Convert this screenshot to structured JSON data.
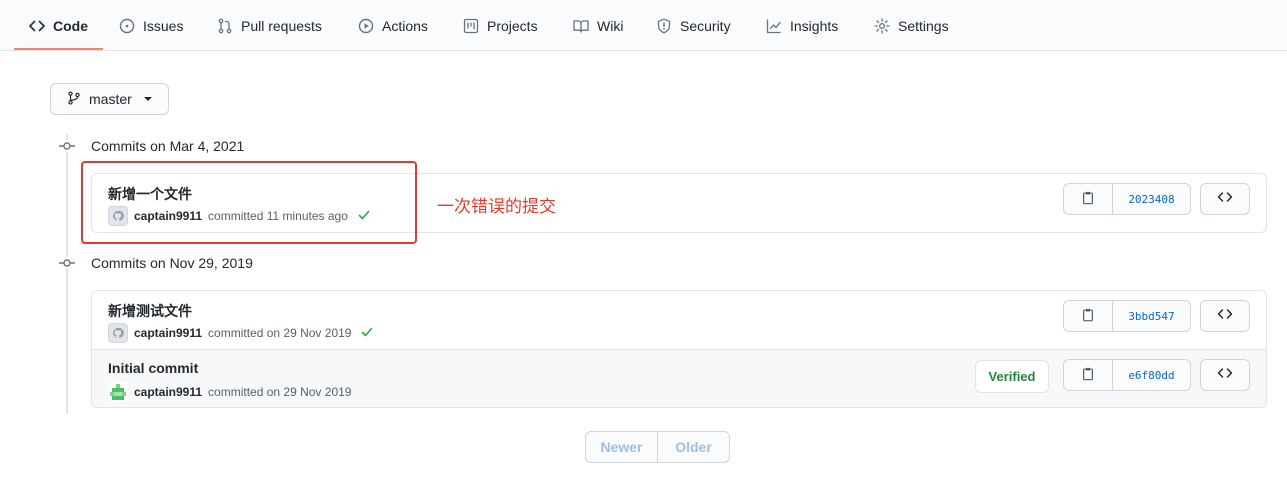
{
  "nav": {
    "tabs": [
      {
        "label": "Code",
        "icon": "code-icon",
        "active": true
      },
      {
        "label": "Issues",
        "icon": "issue-icon"
      },
      {
        "label": "Pull requests",
        "icon": "pull-request-icon"
      },
      {
        "label": "Actions",
        "icon": "play-icon"
      },
      {
        "label": "Projects",
        "icon": "project-icon"
      },
      {
        "label": "Wiki",
        "icon": "book-icon"
      },
      {
        "label": "Security",
        "icon": "shield-icon"
      },
      {
        "label": "Insights",
        "icon": "graph-icon"
      },
      {
        "label": "Settings",
        "icon": "gear-icon"
      }
    ]
  },
  "branch": {
    "name": "master",
    "icon": "git-branch-icon"
  },
  "groups": [
    {
      "title": "Commits on Mar 4, 2021",
      "commits": [
        {
          "message": "新增一个文件",
          "author": "captain9911",
          "committed_text": "committed 11 minutes ago",
          "status": "check",
          "sha": "2023408",
          "verified": false
        }
      ]
    },
    {
      "title": "Commits on Nov 29, 2019",
      "commits": [
        {
          "message": "新增测试文件",
          "author": "captain9911",
          "committed_text": "committed on 29 Nov 2019",
          "status": "check",
          "sha": "3bbd547",
          "verified": false
        },
        {
          "message": "Initial commit",
          "author": "captain9911",
          "committed_text": "committed on 29 Nov 2019",
          "status": "",
          "sha": "e6f80dd",
          "verified": true,
          "verified_label": "Verified"
        }
      ]
    }
  ],
  "annotation": {
    "text": "一次错误的提交",
    "color": "#e8382c"
  },
  "pagination": {
    "newer": "Newer",
    "older": "Older"
  },
  "colors": {
    "accent_underline": "#f9826c",
    "link": "#0366d6",
    "success": "#28a745"
  }
}
